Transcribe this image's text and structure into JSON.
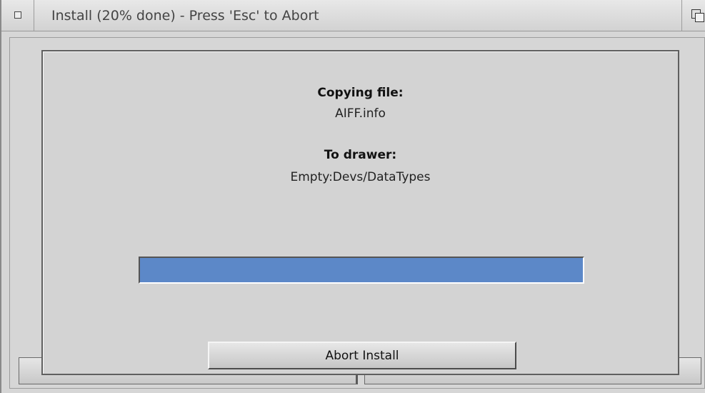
{
  "window": {
    "title": "Install (20% done) - Press 'Esc' to Abort"
  },
  "dialog": {
    "copying_label": "Copying file:",
    "file_name": "AIFF.info",
    "drawer_label": "To drawer:",
    "drawer_path": "Empty:Devs/DataTypes",
    "progress_percent": 100,
    "abort_label": "Abort Install"
  },
  "colors": {
    "progress_fill": "#5c88c8",
    "background": "#d4d4d4"
  }
}
